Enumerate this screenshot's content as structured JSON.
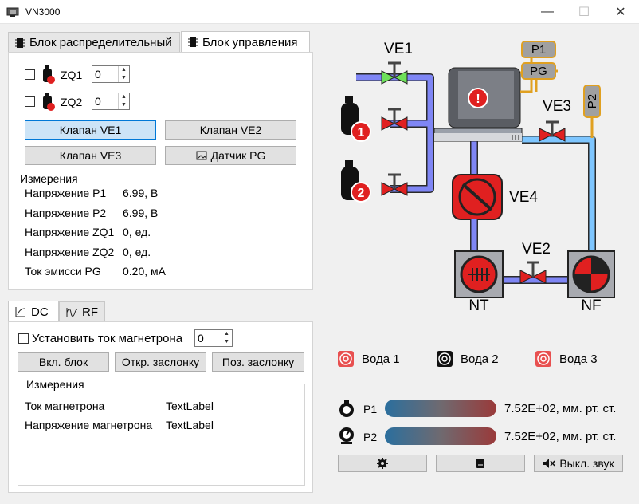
{
  "window": {
    "title": "VN3000",
    "min": "—",
    "max": "☐",
    "close": "✕"
  },
  "tabs_top": [
    {
      "label": "Блок распределительный",
      "active": false
    },
    {
      "label": "Блок управления",
      "active": true
    }
  ],
  "zq": [
    {
      "label": "ZQ1",
      "value": "0",
      "badge": "1"
    },
    {
      "label": "ZQ2",
      "value": "0",
      "badge": "2"
    }
  ],
  "valve_buttons": [
    "Клапан VE1",
    "Клапан VE2",
    "Клапан VE3",
    "Датчик PG"
  ],
  "measure_title": "Измерения",
  "measurements": [
    {
      "name": "Напряжение P1",
      "value": "6.99, В"
    },
    {
      "name": "Напряжение P2",
      "value": "6.99, В"
    },
    {
      "name": "Напряжение ZQ1",
      "value": "0, ед."
    },
    {
      "name": "Напряжение ZQ2",
      "value": "0, ед."
    },
    {
      "name": "Ток эмисси PG",
      "value": "0.20, мА"
    }
  ],
  "tabs_bottom": [
    {
      "label": "DC",
      "active": true
    },
    {
      "label": "RF",
      "active": false
    }
  ],
  "magnetron": {
    "label": "Установить ток магнетрона",
    "value": "0"
  },
  "bottom_buttons": [
    "Вкл. блок",
    "Откр. заслонку",
    "Поз. заслонку"
  ],
  "measure2_title": "Измерения",
  "measurements2": [
    {
      "name": "Ток магнетрона",
      "value": "TextLabel"
    },
    {
      "name": "Напряжение магнетрона",
      "value": "TextLabel"
    }
  ],
  "diagram": {
    "ve1": "VE1",
    "ve2": "VE2",
    "ve3": "VE3",
    "ve4": "VE4",
    "p1": "P1",
    "pg": "PG",
    "p2": "P2",
    "nt": "NT",
    "nf": "NF",
    "gas1": "1",
    "gas2": "2",
    "warn": "!"
  },
  "water": [
    "Вода 1",
    "Вода 2",
    "Вода 3"
  ],
  "pressure": [
    {
      "label": "P1",
      "value": "7.52E+02, мм. рт. ст."
    },
    {
      "label": "P2",
      "value": "7.52E+02, мм. рт. ст."
    }
  ],
  "footer": {
    "mute": "Выкл. звук"
  }
}
